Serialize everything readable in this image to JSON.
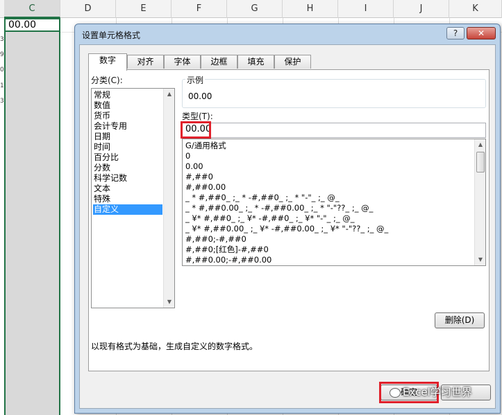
{
  "sheet": {
    "columns": [
      "C",
      "D",
      "E",
      "F",
      "G",
      "H",
      "I",
      "J",
      "K"
    ],
    "selected_column": "C",
    "cell_value": "00.00",
    "row_fragments": [
      "3",
      "9",
      "0",
      "1",
      "3"
    ]
  },
  "dialog": {
    "title": "设置单元格格式",
    "help_label": "?",
    "close_label": "✕",
    "tabs": [
      "数字",
      "对齐",
      "字体",
      "边框",
      "填充",
      "保护"
    ],
    "active_tab": "数字",
    "category_label": "分类(C):",
    "categories": [
      "常规",
      "数值",
      "货币",
      "会计专用",
      "日期",
      "时间",
      "百分比",
      "分数",
      "科学记数",
      "文本",
      "特殊",
      "自定义"
    ],
    "selected_category": "自定义",
    "sample_label": "示例",
    "sample_value": "00.00",
    "type_label": "类型(T):",
    "type_value": "00.00",
    "format_list": [
      "G/通用格式",
      "0",
      "0.00",
      "#,##0",
      "#,##0.00",
      "_ * #,##0_ ;_ * -#,##0_ ;_ * \"-\"_ ;_ @_",
      "_ * #,##0.00_ ;_ * -#,##0.00_ ;_ * \"-\"??_ ;_ @_",
      "_ ¥* #,##0_ ;_ ¥* -#,##0_ ;_ ¥* \"-\"_ ;_ @_",
      "_ ¥* #,##0.00_ ;_ ¥* -#,##0.00_ ;_ ¥* \"-\"??_ ;_ @_",
      "#,##0;-#,##0",
      "#,##0;[红色]-#,##0",
      "#,##0.00;-#,##0.00"
    ],
    "delete_button": "删除(D)",
    "description": "以现有格式为基础，生成自定义的数字格式。",
    "ok_button": "确定",
    "watermark": "Excel学习世界"
  },
  "colors": {
    "accent_green": "#217346",
    "highlight_red": "#e0212b",
    "selection_blue": "#3399ff"
  }
}
